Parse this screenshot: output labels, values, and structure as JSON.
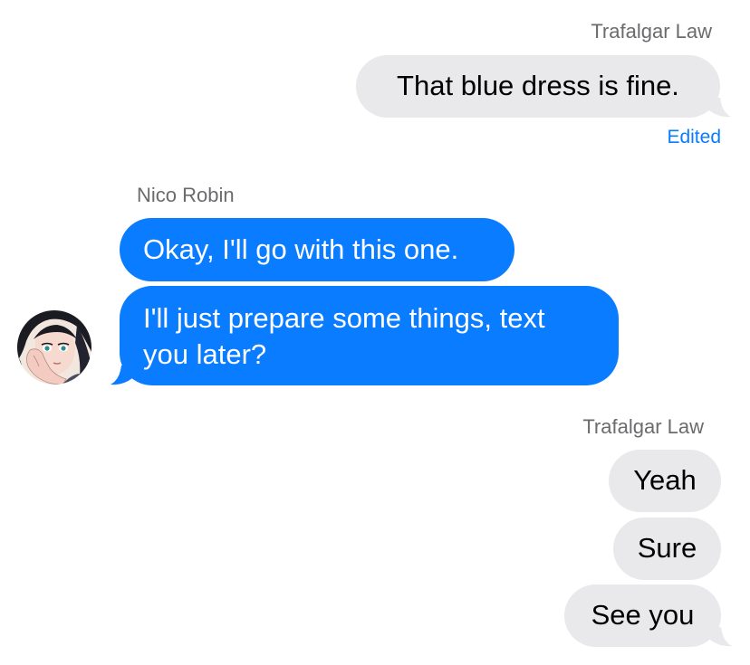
{
  "conversation": {
    "groups": [
      {
        "sender": "Trafalgar Law",
        "messages": [
          "That blue dress is fine."
        ],
        "status": "Edited"
      },
      {
        "sender": "Nico Robin",
        "messages": [
          "Okay, I'll go with this one.",
          "I'll just prepare some things, text you later?"
        ]
      },
      {
        "sender": "Trafalgar Law",
        "messages": [
          "Yeah",
          "Sure",
          "See you"
        ]
      }
    ]
  },
  "colors": {
    "outgoing_bubble": "#e9e9eb",
    "incoming_bubble": "#0a7cff",
    "edited_label": "#0a7cff",
    "sender_label": "#6b6b6e"
  },
  "icons": {
    "avatar": "nico-robin-avatar"
  }
}
